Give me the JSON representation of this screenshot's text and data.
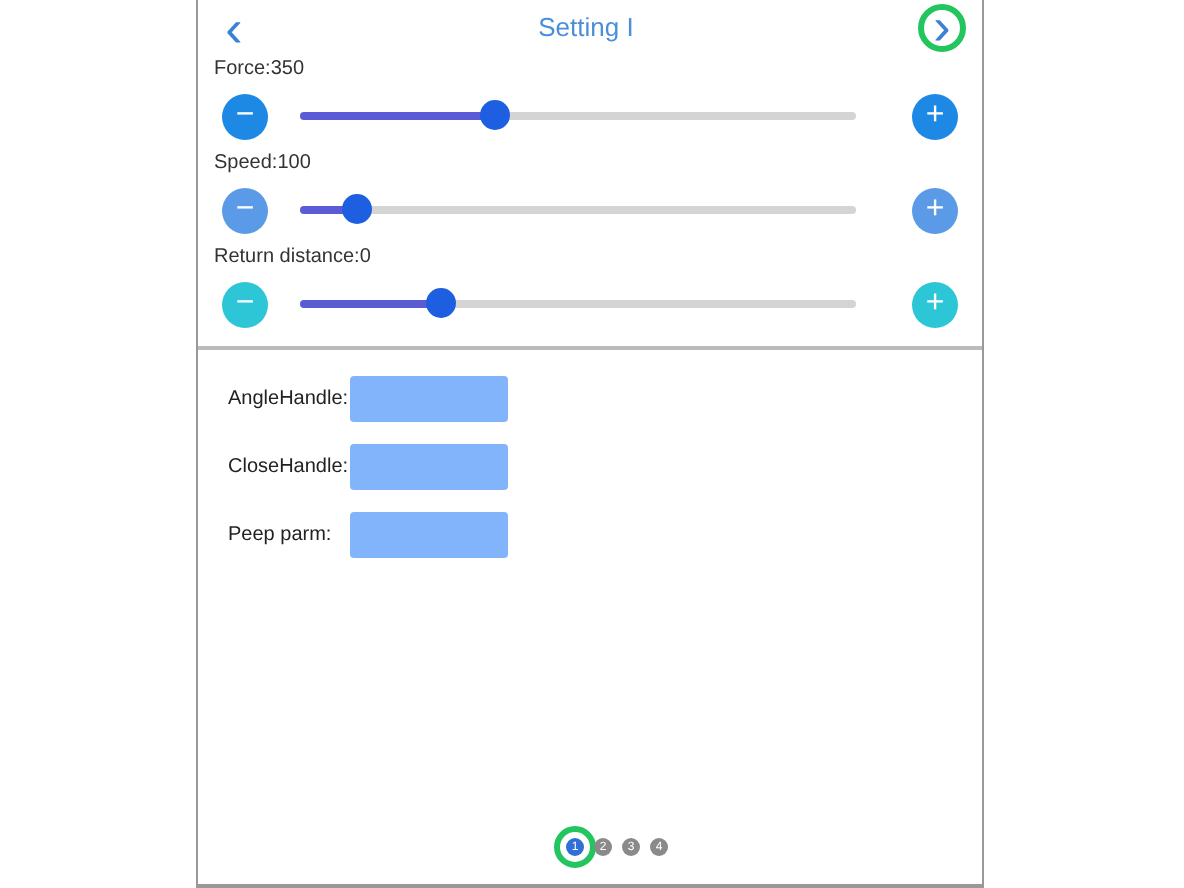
{
  "header": {
    "back": "‹",
    "title": "Setting I",
    "next": "›"
  },
  "sliders": [
    {
      "label": "Force:350",
      "level": 0.35,
      "color": "#1e88e5",
      "minus": "−",
      "plus": "+"
    },
    {
      "label": "Speed:100",
      "level": 0.1,
      "color": "#5b9ae6",
      "minus": "−",
      "plus": "+"
    },
    {
      "label": "Return distance:0",
      "level": 0.25,
      "color": "#2cc6d6",
      "minus": "−",
      "plus": "+"
    }
  ],
  "fields": [
    {
      "label": "AngleHandle:"
    },
    {
      "label": "CloseHandle:"
    },
    {
      "label": "Peep parm:"
    }
  ],
  "pages": [
    {
      "label": "1",
      "selected": true
    },
    {
      "label": "2",
      "selected": false
    },
    {
      "label": "3",
      "selected": false
    },
    {
      "label": "4",
      "selected": false
    }
  ]
}
